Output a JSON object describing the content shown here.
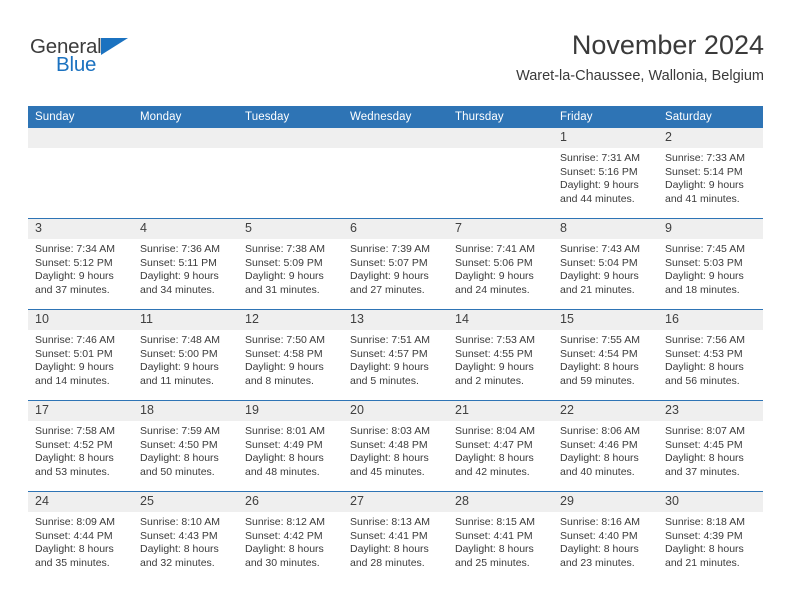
{
  "brand": {
    "name_part1": "General",
    "name_part2": "Blue",
    "accent_color": "#1b72c0"
  },
  "header": {
    "title": "November 2024",
    "subtitle": "Waret-la-Chaussee, Wallonia, Belgium"
  },
  "theme": {
    "header_blue": "#2e74b5",
    "daynum_band": "#efefef",
    "text": "#3b3b3b"
  },
  "weekday_headers": [
    "Sunday",
    "Monday",
    "Tuesday",
    "Wednesday",
    "Thursday",
    "Friday",
    "Saturday"
  ],
  "labels": {
    "sunrise_prefix": "Sunrise:",
    "sunset_prefix": "Sunset:",
    "daylight_prefix": "Daylight:"
  },
  "weeks": [
    [
      {
        "day": "",
        "sunrise": "",
        "sunset": "",
        "daylight_line1": "",
        "daylight_line2": ""
      },
      {
        "day": "",
        "sunrise": "",
        "sunset": "",
        "daylight_line1": "",
        "daylight_line2": ""
      },
      {
        "day": "",
        "sunrise": "",
        "sunset": "",
        "daylight_line1": "",
        "daylight_line2": ""
      },
      {
        "day": "",
        "sunrise": "",
        "sunset": "",
        "daylight_line1": "",
        "daylight_line2": ""
      },
      {
        "day": "",
        "sunrise": "",
        "sunset": "",
        "daylight_line1": "",
        "daylight_line2": ""
      },
      {
        "day": "1",
        "sunrise": "Sunrise: 7:31 AM",
        "sunset": "Sunset: 5:16 PM",
        "daylight_line1": "Daylight: 9 hours",
        "daylight_line2": "and 44 minutes."
      },
      {
        "day": "2",
        "sunrise": "Sunrise: 7:33 AM",
        "sunset": "Sunset: 5:14 PM",
        "daylight_line1": "Daylight: 9 hours",
        "daylight_line2": "and 41 minutes."
      }
    ],
    [
      {
        "day": "3",
        "sunrise": "Sunrise: 7:34 AM",
        "sunset": "Sunset: 5:12 PM",
        "daylight_line1": "Daylight: 9 hours",
        "daylight_line2": "and 37 minutes."
      },
      {
        "day": "4",
        "sunrise": "Sunrise: 7:36 AM",
        "sunset": "Sunset: 5:11 PM",
        "daylight_line1": "Daylight: 9 hours",
        "daylight_line2": "and 34 minutes."
      },
      {
        "day": "5",
        "sunrise": "Sunrise: 7:38 AM",
        "sunset": "Sunset: 5:09 PM",
        "daylight_line1": "Daylight: 9 hours",
        "daylight_line2": "and 31 minutes."
      },
      {
        "day": "6",
        "sunrise": "Sunrise: 7:39 AM",
        "sunset": "Sunset: 5:07 PM",
        "daylight_line1": "Daylight: 9 hours",
        "daylight_line2": "and 27 minutes."
      },
      {
        "day": "7",
        "sunrise": "Sunrise: 7:41 AM",
        "sunset": "Sunset: 5:06 PM",
        "daylight_line1": "Daylight: 9 hours",
        "daylight_line2": "and 24 minutes."
      },
      {
        "day": "8",
        "sunrise": "Sunrise: 7:43 AM",
        "sunset": "Sunset: 5:04 PM",
        "daylight_line1": "Daylight: 9 hours",
        "daylight_line2": "and 21 minutes."
      },
      {
        "day": "9",
        "sunrise": "Sunrise: 7:45 AM",
        "sunset": "Sunset: 5:03 PM",
        "daylight_line1": "Daylight: 9 hours",
        "daylight_line2": "and 18 minutes."
      }
    ],
    [
      {
        "day": "10",
        "sunrise": "Sunrise: 7:46 AM",
        "sunset": "Sunset: 5:01 PM",
        "daylight_line1": "Daylight: 9 hours",
        "daylight_line2": "and 14 minutes."
      },
      {
        "day": "11",
        "sunrise": "Sunrise: 7:48 AM",
        "sunset": "Sunset: 5:00 PM",
        "daylight_line1": "Daylight: 9 hours",
        "daylight_line2": "and 11 minutes."
      },
      {
        "day": "12",
        "sunrise": "Sunrise: 7:50 AM",
        "sunset": "Sunset: 4:58 PM",
        "daylight_line1": "Daylight: 9 hours",
        "daylight_line2": "and 8 minutes."
      },
      {
        "day": "13",
        "sunrise": "Sunrise: 7:51 AM",
        "sunset": "Sunset: 4:57 PM",
        "daylight_line1": "Daylight: 9 hours",
        "daylight_line2": "and 5 minutes."
      },
      {
        "day": "14",
        "sunrise": "Sunrise: 7:53 AM",
        "sunset": "Sunset: 4:55 PM",
        "daylight_line1": "Daylight: 9 hours",
        "daylight_line2": "and 2 minutes."
      },
      {
        "day": "15",
        "sunrise": "Sunrise: 7:55 AM",
        "sunset": "Sunset: 4:54 PM",
        "daylight_line1": "Daylight: 8 hours",
        "daylight_line2": "and 59 minutes."
      },
      {
        "day": "16",
        "sunrise": "Sunrise: 7:56 AM",
        "sunset": "Sunset: 4:53 PM",
        "daylight_line1": "Daylight: 8 hours",
        "daylight_line2": "and 56 minutes."
      }
    ],
    [
      {
        "day": "17",
        "sunrise": "Sunrise: 7:58 AM",
        "sunset": "Sunset: 4:52 PM",
        "daylight_line1": "Daylight: 8 hours",
        "daylight_line2": "and 53 minutes."
      },
      {
        "day": "18",
        "sunrise": "Sunrise: 7:59 AM",
        "sunset": "Sunset: 4:50 PM",
        "daylight_line1": "Daylight: 8 hours",
        "daylight_line2": "and 50 minutes."
      },
      {
        "day": "19",
        "sunrise": "Sunrise: 8:01 AM",
        "sunset": "Sunset: 4:49 PM",
        "daylight_line1": "Daylight: 8 hours",
        "daylight_line2": "and 48 minutes."
      },
      {
        "day": "20",
        "sunrise": "Sunrise: 8:03 AM",
        "sunset": "Sunset: 4:48 PM",
        "daylight_line1": "Daylight: 8 hours",
        "daylight_line2": "and 45 minutes."
      },
      {
        "day": "21",
        "sunrise": "Sunrise: 8:04 AM",
        "sunset": "Sunset: 4:47 PM",
        "daylight_line1": "Daylight: 8 hours",
        "daylight_line2": "and 42 minutes."
      },
      {
        "day": "22",
        "sunrise": "Sunrise: 8:06 AM",
        "sunset": "Sunset: 4:46 PM",
        "daylight_line1": "Daylight: 8 hours",
        "daylight_line2": "and 40 minutes."
      },
      {
        "day": "23",
        "sunrise": "Sunrise: 8:07 AM",
        "sunset": "Sunset: 4:45 PM",
        "daylight_line1": "Daylight: 8 hours",
        "daylight_line2": "and 37 minutes."
      }
    ],
    [
      {
        "day": "24",
        "sunrise": "Sunrise: 8:09 AM",
        "sunset": "Sunset: 4:44 PM",
        "daylight_line1": "Daylight: 8 hours",
        "daylight_line2": "and 35 minutes."
      },
      {
        "day": "25",
        "sunrise": "Sunrise: 8:10 AM",
        "sunset": "Sunset: 4:43 PM",
        "daylight_line1": "Daylight: 8 hours",
        "daylight_line2": "and 32 minutes."
      },
      {
        "day": "26",
        "sunrise": "Sunrise: 8:12 AM",
        "sunset": "Sunset: 4:42 PM",
        "daylight_line1": "Daylight: 8 hours",
        "daylight_line2": "and 30 minutes."
      },
      {
        "day": "27",
        "sunrise": "Sunrise: 8:13 AM",
        "sunset": "Sunset: 4:41 PM",
        "daylight_line1": "Daylight: 8 hours",
        "daylight_line2": "and 28 minutes."
      },
      {
        "day": "28",
        "sunrise": "Sunrise: 8:15 AM",
        "sunset": "Sunset: 4:41 PM",
        "daylight_line1": "Daylight: 8 hours",
        "daylight_line2": "and 25 minutes."
      },
      {
        "day": "29",
        "sunrise": "Sunrise: 8:16 AM",
        "sunset": "Sunset: 4:40 PM",
        "daylight_line1": "Daylight: 8 hours",
        "daylight_line2": "and 23 minutes."
      },
      {
        "day": "30",
        "sunrise": "Sunrise: 8:18 AM",
        "sunset": "Sunset: 4:39 PM",
        "daylight_line1": "Daylight: 8 hours",
        "daylight_line2": "and 21 minutes."
      }
    ]
  ]
}
